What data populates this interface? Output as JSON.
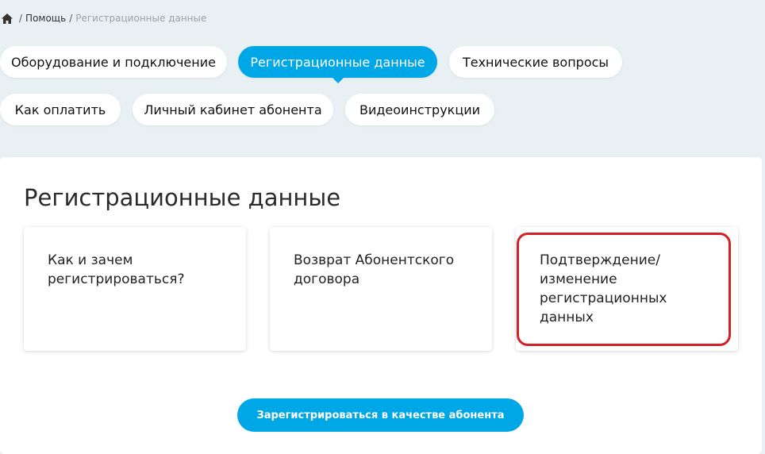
{
  "breadcrumb": {
    "home_icon": "home-icon",
    "separator": "/",
    "items": [
      "Помощь",
      "Регистрационные данные"
    ]
  },
  "tabs": [
    {
      "label": "Оборудование и подключение",
      "active": false
    },
    {
      "label": "Регистрационные данные",
      "active": true
    },
    {
      "label": "Технические вопросы",
      "active": false
    },
    {
      "label": "Как оплатить",
      "active": false
    },
    {
      "label": "Личный кабинет абонента",
      "active": false
    },
    {
      "label": "Видеоинструкции",
      "active": false
    }
  ],
  "section": {
    "title": "Регистрационные данные",
    "cards": [
      {
        "text": "Как и зачем регистрироваться?"
      },
      {
        "text": "Возврат Абонентского договора"
      },
      {
        "text": "Подтверждение/ изменение регистрационных данных",
        "highlighted": true
      }
    ]
  },
  "cta": {
    "label": "Зарегистрироваться в качестве абонента"
  },
  "colors": {
    "accent": "#00a7e6",
    "background": "#e8f0f3",
    "highlight": "#d42027"
  }
}
